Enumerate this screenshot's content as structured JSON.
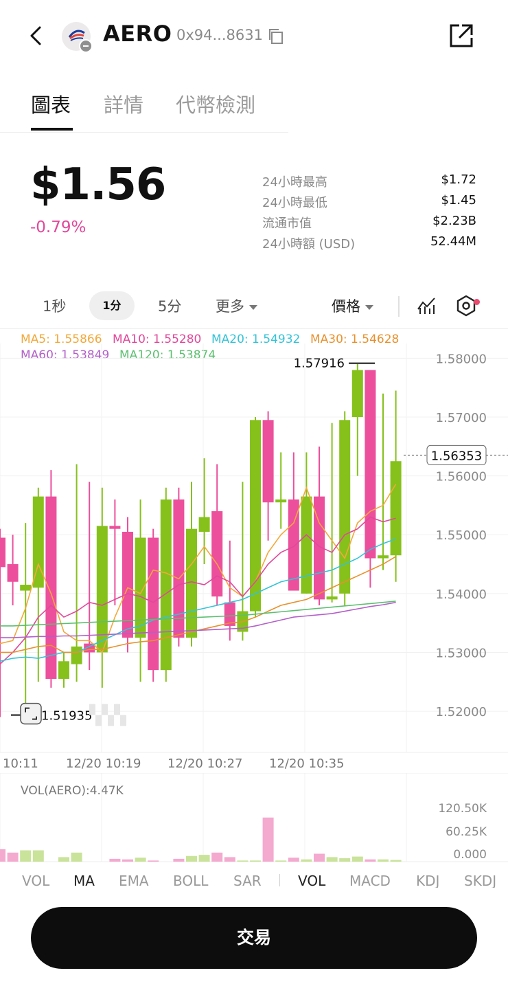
{
  "header": {
    "symbol": "AERO",
    "address": "0x94...8631"
  },
  "tabs": [
    "圖表",
    "詳情",
    "代幣檢測"
  ],
  "price": {
    "value": "$1.56",
    "change": "-0.79%"
  },
  "stats": [
    {
      "label": "24小時最高",
      "value": "$1.72"
    },
    {
      "label": "24小時最低",
      "value": "$1.45"
    },
    {
      "label": "流通市值",
      "value": "$2.23B"
    },
    {
      "label": "24小時額 (USD)",
      "value": "52.44M"
    }
  ],
  "toolbar": {
    "timeframes": [
      "1秒",
      "1分",
      "5分"
    ],
    "more": "更多",
    "price_mode": "價格"
  },
  "ma_legend": [
    {
      "text": "MA5: 1.55866",
      "color": "#f2a93b"
    },
    {
      "text": "MA10: 1.55280",
      "color": "#e0489a"
    },
    {
      "text": "MA20: 1.54932",
      "color": "#33c3d6"
    },
    {
      "text": "MA30: 1.54628",
      "color": "#e8912e"
    },
    {
      "text": "MA60: 1.53849",
      "color": "#b35fc9"
    },
    {
      "text": "MA120: 1.53874",
      "color": "#5cbf70"
    }
  ],
  "colors": {
    "up": "#86c11b",
    "down": "#ec4f9c",
    "accent_negative": "#e0489a"
  },
  "chart_data": {
    "type": "candlestick",
    "y_ticks": [
      "1.58000",
      "1.57000",
      "1.56000",
      "1.55000",
      "1.54000",
      "1.53000",
      "1.52000"
    ],
    "x_ticks": [
      "10:11",
      "12/20 10:19",
      "12/20 10:27",
      "12/20 10:35"
    ],
    "high_label": "1.57916",
    "low_label": "1.51935",
    "current_label": "1.56353",
    "ylim": [
      1.513,
      1.5825
    ],
    "candles": [
      {
        "o": 1.5495,
        "h": 1.551,
        "l": 1.519,
        "c": 1.5445
      },
      {
        "o": 1.545,
        "h": 1.55,
        "l": 1.538,
        "c": 1.542
      },
      {
        "o": 1.5405,
        "h": 1.552,
        "l": 1.521,
        "c": 1.5415
      },
      {
        "o": 1.541,
        "h": 1.558,
        "l": 1.525,
        "c": 1.5565
      },
      {
        "o": 1.5565,
        "h": 1.561,
        "l": 1.524,
        "c": 1.5255
      },
      {
        "o": 1.5255,
        "h": 1.53,
        "l": 1.524,
        "c": 1.5285
      },
      {
        "o": 1.528,
        "h": 1.562,
        "l": 1.525,
        "c": 1.531
      },
      {
        "o": 1.5315,
        "h": 1.559,
        "l": 1.527,
        "c": 1.53
      },
      {
        "o": 1.53,
        "h": 1.558,
        "l": 1.524,
        "c": 1.5515
      },
      {
        "o": 1.5515,
        "h": 1.556,
        "l": 1.538,
        "c": 1.551
      },
      {
        "o": 1.5505,
        "h": 1.553,
        "l": 1.53,
        "c": 1.5325
      },
      {
        "o": 1.5325,
        "h": 1.556,
        "l": 1.525,
        "c": 1.5495
      },
      {
        "o": 1.5495,
        "h": 1.551,
        "l": 1.525,
        "c": 1.527
      },
      {
        "o": 1.527,
        "h": 1.558,
        "l": 1.525,
        "c": 1.556
      },
      {
        "o": 1.556,
        "h": 1.558,
        "l": 1.531,
        "c": 1.5325
      },
      {
        "o": 1.5325,
        "h": 1.559,
        "l": 1.531,
        "c": 1.551
      },
      {
        "o": 1.5505,
        "h": 1.563,
        "l": 1.545,
        "c": 1.553
      },
      {
        "o": 1.554,
        "h": 1.562,
        "l": 1.538,
        "c": 1.5395
      },
      {
        "o": 1.5385,
        "h": 1.549,
        "l": 1.532,
        "c": 1.5345
      },
      {
        "o": 1.5335,
        "h": 1.559,
        "l": 1.532,
        "c": 1.537
      },
      {
        "o": 1.537,
        "h": 1.57,
        "l": 1.536,
        "c": 1.5695
      },
      {
        "o": 1.5695,
        "h": 1.571,
        "l": 1.549,
        "c": 1.5555
      },
      {
        "o": 1.5555,
        "h": 1.564,
        "l": 1.551,
        "c": 1.556
      },
      {
        "o": 1.556,
        "h": 1.564,
        "l": 1.541,
        "c": 1.5405
      },
      {
        "o": 1.54,
        "h": 1.564,
        "l": 1.54,
        "c": 1.5565
      },
      {
        "o": 1.5565,
        "h": 1.565,
        "l": 1.538,
        "c": 1.539
      },
      {
        "o": 1.539,
        "h": 1.569,
        "l": 1.5385,
        "c": 1.5395
      },
      {
        "o": 1.54,
        "h": 1.571,
        "l": 1.538,
        "c": 1.5695
      },
      {
        "o": 1.57,
        "h": 1.579,
        "l": 1.56,
        "c": 1.578
      },
      {
        "o": 1.578,
        "h": 1.578,
        "l": 1.541,
        "c": 1.546
      },
      {
        "o": 1.546,
        "h": 1.574,
        "l": 1.544,
        "c": 1.5465
      },
      {
        "o": 1.5465,
        "h": 1.5745,
        "l": 1.542,
        "c": 1.5625
      }
    ],
    "ma_lines": {
      "MA5": [
        1.5315,
        1.532,
        1.5375,
        1.545,
        1.54,
        1.5335,
        1.532,
        1.532,
        1.53,
        1.536,
        1.541,
        1.54,
        1.544,
        1.5435,
        1.5425,
        1.545,
        1.548,
        1.545,
        1.541,
        1.5395,
        1.542,
        1.547,
        1.55,
        1.552,
        1.558,
        1.552,
        1.549,
        1.546,
        1.552,
        1.554,
        1.555,
        1.5586
      ],
      "MA10": [
        1.528,
        1.53,
        1.5325,
        1.536,
        1.538,
        1.536,
        1.537,
        1.5385,
        1.538,
        1.539,
        1.54,
        1.5395,
        1.5385,
        1.54,
        1.5415,
        1.542,
        1.5415,
        1.543,
        1.542,
        1.5395,
        1.542,
        1.545,
        1.547,
        1.548,
        1.55,
        1.548,
        1.547,
        1.55,
        1.551,
        1.553,
        1.5522,
        1.5528
      ],
      "MA20": [
        1.5285,
        1.529,
        1.5292,
        1.529,
        1.5295,
        1.53,
        1.53,
        1.531,
        1.532,
        1.533,
        1.534,
        1.5345,
        1.5355,
        1.536,
        1.5365,
        1.537,
        1.5375,
        1.538,
        1.5385,
        1.539,
        1.54,
        1.541,
        1.542,
        1.5425,
        1.543,
        1.5435,
        1.544,
        1.545,
        1.546,
        1.5475,
        1.5485,
        1.5493
      ],
      "MA30": [
        1.53,
        1.53,
        1.5305,
        1.531,
        1.5312,
        1.53,
        1.53,
        1.5305,
        1.5305,
        1.531,
        1.5315,
        1.5318,
        1.532,
        1.5325,
        1.533,
        1.5335,
        1.534,
        1.5345,
        1.535,
        1.5352,
        1.536,
        1.537,
        1.538,
        1.5385,
        1.539,
        1.54,
        1.541,
        1.542,
        1.543,
        1.544,
        1.545,
        1.5463
      ],
      "MA60": [
        1.5325,
        1.5325,
        1.5326,
        1.5327,
        1.5327,
        1.5328,
        1.5328,
        1.5329,
        1.533,
        1.5331,
        1.5332,
        1.5333,
        1.5334,
        1.5335,
        1.5336,
        1.5337,
        1.5338,
        1.5339,
        1.534,
        1.5341,
        1.5345,
        1.535,
        1.5355,
        1.536,
        1.5362,
        1.5364,
        1.5366,
        1.537,
        1.5374,
        1.5378,
        1.5381,
        1.5385
      ],
      "MA120": [
        1.5345,
        1.5345,
        1.5346,
        1.5347,
        1.5348,
        1.5349,
        1.535,
        1.5351,
        1.5352,
        1.5353,
        1.5354,
        1.5355,
        1.5356,
        1.5357,
        1.5358,
        1.5359,
        1.536,
        1.5361,
        1.5362,
        1.5363,
        1.5365,
        1.5367,
        1.5369,
        1.5371,
        1.5373,
        1.5375,
        1.5377,
        1.5379,
        1.5381,
        1.5383,
        1.5385,
        1.5387
      ]
    },
    "volume": {
      "label": "VOL(AERO):4.47K",
      "y_ticks": [
        "120.50K",
        "60.25K",
        "0.000"
      ],
      "ylim": [
        0,
        130000
      ],
      "values": [
        22000,
        16000,
        20000,
        20000,
        0,
        8000,
        16000,
        0,
        0,
        5000,
        4000,
        7000,
        2000,
        0,
        5000,
        10000,
        12000,
        16000,
        8000,
        2000,
        2000,
        78000,
        2000,
        7000,
        4000,
        14000,
        8000,
        6000,
        9000,
        4000,
        4000,
        3000
      ]
    }
  },
  "indicator_tabs": [
    "VOL",
    "MA",
    "EMA",
    "BOLL",
    "SAR",
    "VOL",
    "MACD",
    "KDJ",
    "SKDJ"
  ],
  "trade_button": "交易"
}
